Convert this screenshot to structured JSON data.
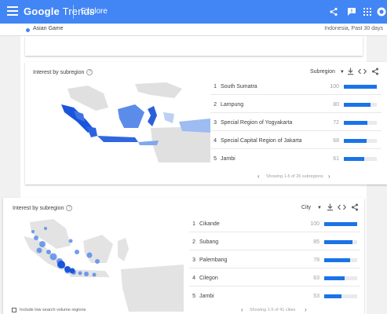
{
  "header": {
    "brand_google": "Google",
    "brand_trends": "Trends",
    "section": "Explore"
  },
  "subheader": {
    "term": "Asian Game",
    "range": "Indonesia, Past 30 days"
  },
  "panel1": {
    "title": "Interest by subregion",
    "dropdown": "Subregion",
    "rows": [
      {
        "rank": "1",
        "name": "South Sumatra",
        "value": "100",
        "pct": 100
      },
      {
        "rank": "2",
        "name": "Lampung",
        "value": "80",
        "pct": 80
      },
      {
        "rank": "3",
        "name": "Special Region of Yogyakarta",
        "value": "72",
        "pct": 72
      },
      {
        "rank": "4",
        "name": "Special Capital Region of Jakarta",
        "value": "68",
        "pct": 68
      },
      {
        "rank": "5",
        "name": "Jambi",
        "value": "61",
        "pct": 61
      }
    ],
    "footer": "Showing 1-5 of 26 subregions"
  },
  "panel2": {
    "title": "Interest by subregion",
    "dropdown": "City",
    "rows": [
      {
        "rank": "1",
        "name": "Cikande",
        "value": "100",
        "pct": 100
      },
      {
        "rank": "2",
        "name": "Subang",
        "value": "85",
        "pct": 85
      },
      {
        "rank": "3",
        "name": "Palembang",
        "value": "78",
        "pct": 78
      },
      {
        "rank": "4",
        "name": "Cilegon",
        "value": "63",
        "pct": 63
      },
      {
        "rank": "5",
        "name": "Jambi",
        "value": "53",
        "pct": 53
      }
    ],
    "footer": "Showing 1-5 of 41 cities",
    "checkbox_label": "Include low search volume regions"
  },
  "colors": {
    "header": "#4285f4",
    "bar": "#1a73e8",
    "map_land": "#d9d9d9",
    "map_high": "#1a56db",
    "map_low": "#7fa8ef"
  },
  "icons": [
    "menu-icon",
    "share-icon",
    "feedback-icon",
    "apps-icon",
    "account-icon",
    "help-icon",
    "dropdown-arrow-icon",
    "download-icon",
    "embed-icon",
    "share-icon",
    "chevron-left-icon",
    "chevron-right-icon"
  ]
}
